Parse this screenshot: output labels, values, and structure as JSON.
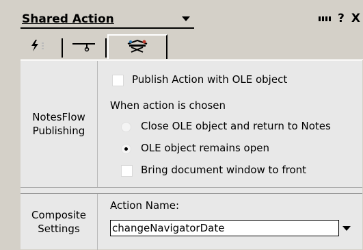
{
  "panel": {
    "title": "Shared Action",
    "help_label": "?",
    "close_label": "X"
  },
  "tabs": [
    {
      "icon": "lightning-icon",
      "active": false
    },
    {
      "icon": "hook-icon",
      "active": false
    },
    {
      "icon": "cabinet-icon",
      "active": true
    }
  ],
  "notesflow": {
    "section_label": "NotesFlow\nPublishing",
    "publish_checkbox": {
      "label": "Publish Action with OLE object",
      "checked": false
    },
    "when_chosen_label": "When action is chosen",
    "radio_close": {
      "label": "Close OLE object and return to Notes",
      "selected": false
    },
    "radio_remain": {
      "label": "OLE object remains open",
      "selected": true
    },
    "bring_front_checkbox": {
      "label": "Bring document window to front",
      "checked": false
    }
  },
  "composite": {
    "section_label": "Composite\nSettings",
    "action_name_label": "Action Name:",
    "action_name_value": "changeNavigatorDate"
  }
}
